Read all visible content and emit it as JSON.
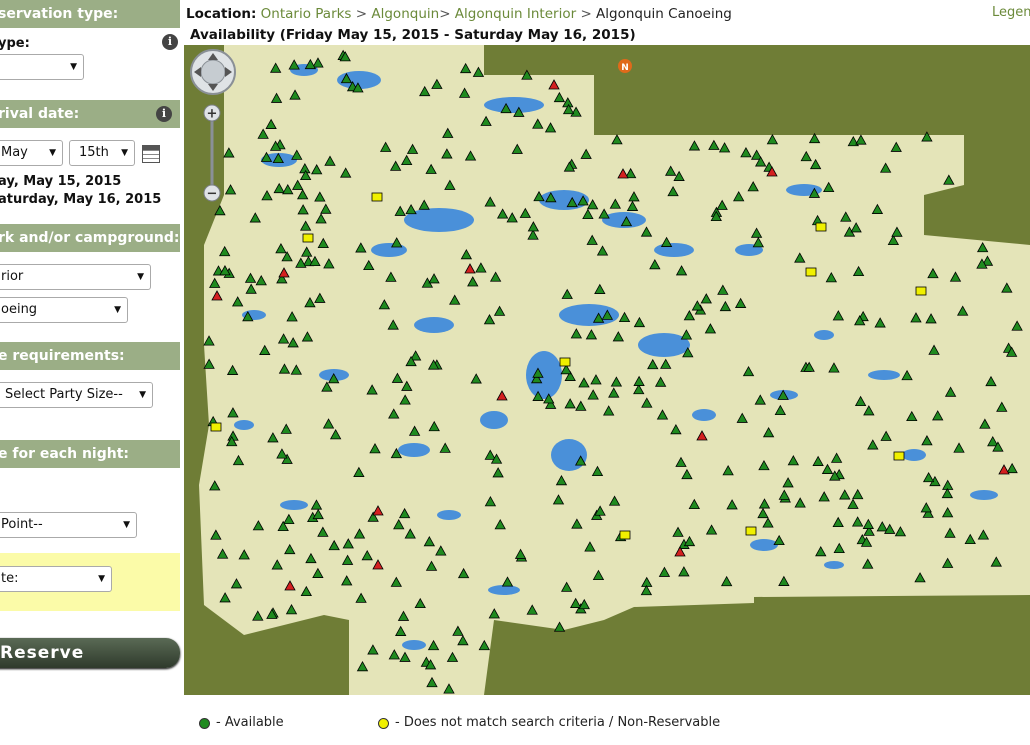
{
  "sidebar": {
    "reservation_type_heading": "servation type:",
    "type_label": "ype:",
    "type_select": "",
    "arrival_heading": "rival date:",
    "month_select": "May",
    "day_select": "15th",
    "arrival_text": "ay, May 15, 2015",
    "departure_text": "aturday, May 16, 2015",
    "park_heading": "rk and/or campground:",
    "park_select": "rior",
    "campground_select": "oeing",
    "requirements_heading": "e requirements:",
    "party_select": "Select Party Size--",
    "each_night_heading": "e for each night:",
    "access_point_select": "Point--",
    "site_select": "te:",
    "reserve_button": "Reserve"
  },
  "header": {
    "location_label": "Location:",
    "crumbs": [
      "Ontario Parks",
      "Algonquin",
      "Algonquin Interior"
    ],
    "separators": [
      ">",
      ">",
      ">"
    ],
    "current": "Algonquin Canoeing",
    "legend_link": "Legen",
    "availability": "Availability (Friday May 15, 2015 - Saturday May 16, 2015)"
  },
  "map": {
    "north_symbol": "N",
    "zoom_in": "+",
    "zoom_out": "−",
    "colors": {
      "background": "#6f7d36",
      "park": "#e4e4b8",
      "water": "#4a90d9",
      "available": "#1f8a1f",
      "unavailable": "#d42020",
      "non_reservable": "#f0f000"
    }
  },
  "legend": {
    "available": "- Available",
    "non_reservable": "- Does not match search criteria / Non-Reservable"
  }
}
